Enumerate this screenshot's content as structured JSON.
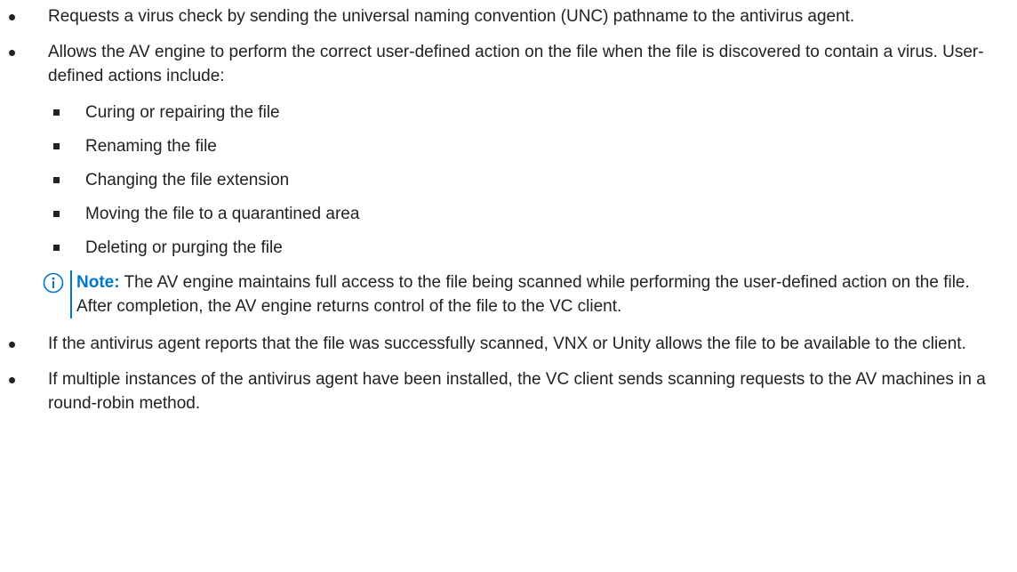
{
  "bullets": {
    "b1": "Requests a virus check by sending the universal naming convention (UNC) pathname to the antivirus agent.",
    "b2": "Allows the AV engine to perform the correct user-defined action on the file when the file is discovered to contain a virus. User-defined actions include:",
    "b2_items": [
      "Curing or repairing the file",
      "Renaming the file",
      "Changing the file extension",
      "Moving the file to a quarantined area",
      "Deleting or purging the file"
    ],
    "note": {
      "label": "Note:",
      "text": " The AV engine maintains full access to the file being scanned while performing the user-defined action on the file. After completion, the AV engine returns control of the file to the VC client.",
      "icon": "info-icon",
      "accent": "#0076ce"
    },
    "b3": "If the antivirus agent reports that the file was successfully scanned, VNX or Unity allows the file to be available to the client.",
    "b4": "If multiple instances of the antivirus agent have been installed, the VC client sends scanning requests to the AV machines in a round-robin method."
  }
}
